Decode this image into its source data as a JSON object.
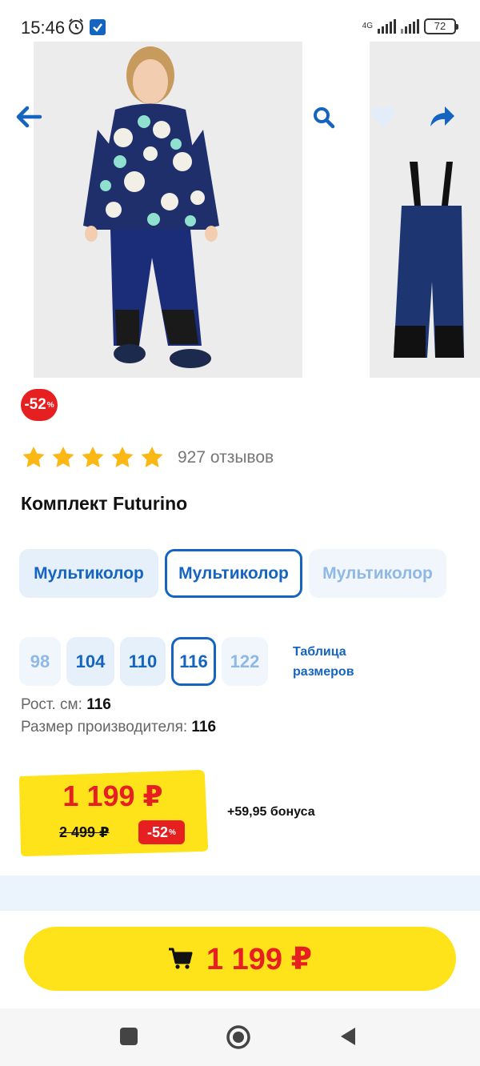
{
  "status_bar": {
    "time": "15:46",
    "network": "4G",
    "battery": "72"
  },
  "top_actions": {
    "back_icon": "arrow-left-icon",
    "search_icon": "search-icon",
    "favorite_icon": "heart-icon",
    "share_icon": "share-icon"
  },
  "product": {
    "discount_badge": "-52",
    "discount_percent_sign": "%",
    "rating_stars": 5,
    "reviews": "927 отзывов",
    "title": "Комплект Futurino"
  },
  "colors": [
    {
      "label": "Мультиколор",
      "state": "normal"
    },
    {
      "label": "Мультиколор",
      "state": "selected"
    },
    {
      "label": "Мультиколор",
      "state": "faded"
    }
  ],
  "sizes": [
    {
      "label": "98",
      "state": "faded"
    },
    {
      "label": "104",
      "state": "normal"
    },
    {
      "label": "110",
      "state": "normal"
    },
    {
      "label": "116",
      "state": "selected"
    },
    {
      "label": "122",
      "state": "faded"
    }
  ],
  "size_table_link": {
    "line1": "Таблица",
    "line2": "размеров"
  },
  "details": {
    "height_label": "Рост. см:",
    "height_value": "116",
    "maker_size_label": "Размер производителя:",
    "maker_size_value": "116"
  },
  "price": {
    "current": "1 199 ₽",
    "old": "2 499 ₽",
    "discount": "-52",
    "discount_sign": "%",
    "bonus": "+59,95 бонуса"
  },
  "buy_button": {
    "icon": "cart-icon",
    "price": "1 199 ₽"
  },
  "colors_theme": {
    "accent": "#1565c0",
    "sale": "#e62020",
    "yellow": "#ffe31a",
    "star": "#fbb713"
  }
}
